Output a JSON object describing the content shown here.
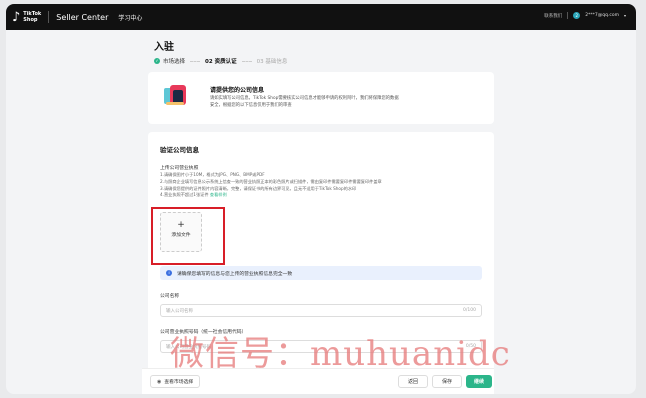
{
  "topbar": {
    "logo_line1": "TikTok",
    "logo_line2": "Shop",
    "brand": "Seller Center",
    "learn": "学习中心",
    "contact": "联系我们",
    "avatar_letter": "2",
    "email": "2***7@qq.com",
    "colors": {
      "bar": "#111111",
      "avatar": "#2aa6b9"
    }
  },
  "header": {
    "title": "入驻",
    "steps": [
      {
        "label": "市场选择",
        "state": "done"
      },
      {
        "label": "02 资质认证",
        "state": "active"
      },
      {
        "label": "03 基础信息",
        "state": "pending"
      }
    ]
  },
  "info": {
    "title": "请提供您的公司信息",
    "desc": "请如实填写公司信息，TikTok Shop需要核实公司信息才能够申请的权利阿叶，我们将保障您的数据安全，根据您的以下信息仅用于我们的审查"
  },
  "form": {
    "section_title": "验证公司信息",
    "upload_label": "上传公司营业执照",
    "rules": [
      "1.请确保图片小于10M，格式为JPG、PNG、BMP或PDF",
      "2.与照商企业填写信息公示系统上信查一致的营业执照正本的彩色照片或扫描件，需由复印件需要复印件需要复印件盖章",
      "3.请确保您提供的证件照片内容清晰，完整，请保证书的所有边界可见，且无不适用于TikTok Shop的水印",
      "4.营业执照不超过1张证件"
    ],
    "rules_link": "查看样例",
    "upload_plus": "+",
    "upload_add": "添加文件",
    "notice": "请确保您填写的信息与您上传的营业执照信息完全一致",
    "company_name_label": "公司名称",
    "company_name_placeholder": "输入公司名称",
    "company_name_count": "0/100",
    "license_no_label": "公司营业执照号码（统一社会信用代码）",
    "license_no_placeholder": "输入公司营业执照号码",
    "license_no_count": "0/50"
  },
  "footer": {
    "market_link": "查看市场选择",
    "back": "返回",
    "save": "保存",
    "next": "继续",
    "colors": {
      "primary": "#2bb58a"
    }
  },
  "watermark": "微信号：muhuanidc"
}
